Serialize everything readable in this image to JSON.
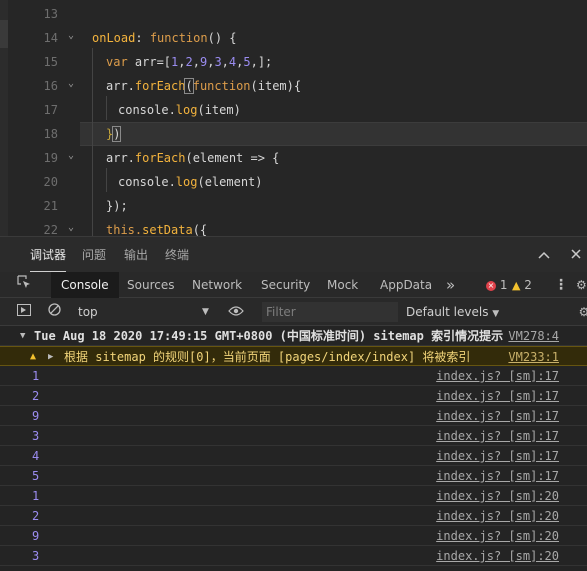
{
  "editor": {
    "line_numbers": [
      "13",
      "14",
      "15",
      "16",
      "17",
      "18",
      "19",
      "20",
      "21",
      "22"
    ],
    "lines": {
      "l14": {
        "a": "onLoad",
        "b": ": ",
        "c": "function",
        "d": "() {"
      },
      "l15": {
        "a": "var ",
        "b": "arr=[",
        "c": "1",
        "d": ",",
        "e": "2",
        "f": ",",
        "g": "9",
        "h": ",",
        "i": "3",
        "j": ",",
        "k": "4",
        "l": ",",
        "m": "5",
        "n": ",];"
      },
      "l16": {
        "a": "arr.",
        "b": "forEach",
        "c": "(",
        "d": "function",
        "e": "(item){"
      },
      "l17": {
        "a": "console.",
        "b": "log",
        "c": "(item)"
      },
      "l18": {
        "a": "}",
        "b": ")"
      },
      "l19": {
        "a": "arr.",
        "b": "forEach",
        "c": "(element => {"
      },
      "l20": {
        "a": "console.",
        "b": "log",
        "c": "(element)"
      },
      "l21": {
        "a": "});"
      },
      "l22": {
        "a": "this.",
        "b": "setData",
        "c": "({"
      }
    }
  },
  "devtools": {
    "top_tabs": [
      "调试器",
      "问题",
      "输出",
      "终端"
    ],
    "panel_tabs": [
      "Console",
      "Sources",
      "Network",
      "Security",
      "Mock",
      "AppData"
    ],
    "more_tabs": "»",
    "error_count": "1",
    "warning_count": "2",
    "context": "top",
    "filter_placeholder": "Filter",
    "levels_label": "Default levels",
    "messages": {
      "group": {
        "text": "Tue Aug 18 2020 17:49:15 GMT+0800 (中国标准时间) sitemap 索引情况提示",
        "source": "VM278:4"
      },
      "warn": {
        "text": "根据 sitemap 的规则[0]，当前页面 [pages/index/index] 将被索引",
        "source": "VM233:1"
      },
      "logs": [
        {
          "value": "1",
          "source": "index.js? [sm]:17"
        },
        {
          "value": "2",
          "source": "index.js? [sm]:17"
        },
        {
          "value": "9",
          "source": "index.js? [sm]:17"
        },
        {
          "value": "3",
          "source": "index.js? [sm]:17"
        },
        {
          "value": "4",
          "source": "index.js? [sm]:17"
        },
        {
          "value": "5",
          "source": "index.js? [sm]:17"
        },
        {
          "value": "1",
          "source": "index.js? [sm]:20"
        },
        {
          "value": "2",
          "source": "index.js? [sm]:20"
        },
        {
          "value": "9",
          "source": "index.js? [sm]:20"
        },
        {
          "value": "3",
          "source": "index.js? [sm]:20"
        }
      ]
    }
  }
}
